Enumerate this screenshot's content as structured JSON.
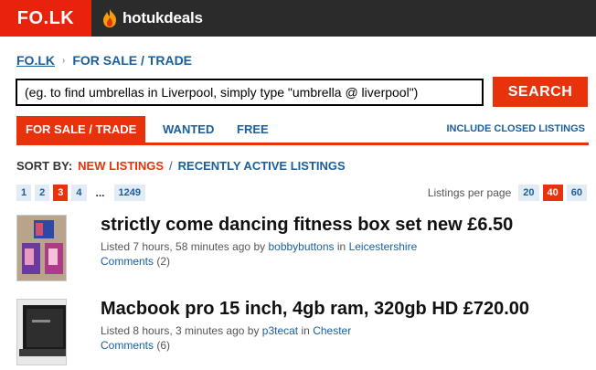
{
  "brand": {
    "folk_logo": "FO.LK",
    "hud_logo": "hotukdeals"
  },
  "breadcrumb": {
    "home": "FO.LK",
    "separator": "›",
    "current": "FOR SALE / TRADE"
  },
  "search": {
    "placeholder": "(eg. to find umbrellas in Liverpool, simply type \"umbrella @ liverpool\")",
    "button_label": "SEARCH"
  },
  "tabs": {
    "for_sale": "FOR SALE / TRADE",
    "wanted": "WANTED",
    "free": "FREE",
    "include_closed": "INCLUDE CLOSED LISTINGS"
  },
  "sort": {
    "label": "SORT BY:",
    "new_listings": "NEW LISTINGS",
    "slash": "/",
    "recently_active": "RECENTLY ACTIVE LISTINGS"
  },
  "pager": {
    "pages": [
      "1",
      "2",
      "3",
      "4"
    ],
    "current": "3",
    "ellipsis": "...",
    "last": "1249"
  },
  "per_page": {
    "label": "Listings per page",
    "options": [
      "20",
      "40",
      "60"
    ],
    "current": "40"
  },
  "listings": [
    {
      "title": "strictly come dancing fitness box set new £6.50",
      "listed_prefix": "Listed 7 hours, 58 minutes ago by",
      "user": "bobbybuttons",
      "in_word": "in",
      "location": "Leicestershire",
      "comments_label": "Comments",
      "comments_count": "(2)"
    },
    {
      "title": "Macbook pro 15 inch, 4gb ram, 320gb HD £720.00",
      "listed_prefix": "Listed 8 hours, 3 minutes ago by",
      "user": "p3tecat",
      "in_word": "in",
      "location": "Chester",
      "comments_label": "Comments",
      "comments_count": "(6)"
    }
  ],
  "colors": {
    "accent": "#e8320c",
    "link": "#1a5e9b",
    "topbar": "#2b2b2b"
  }
}
